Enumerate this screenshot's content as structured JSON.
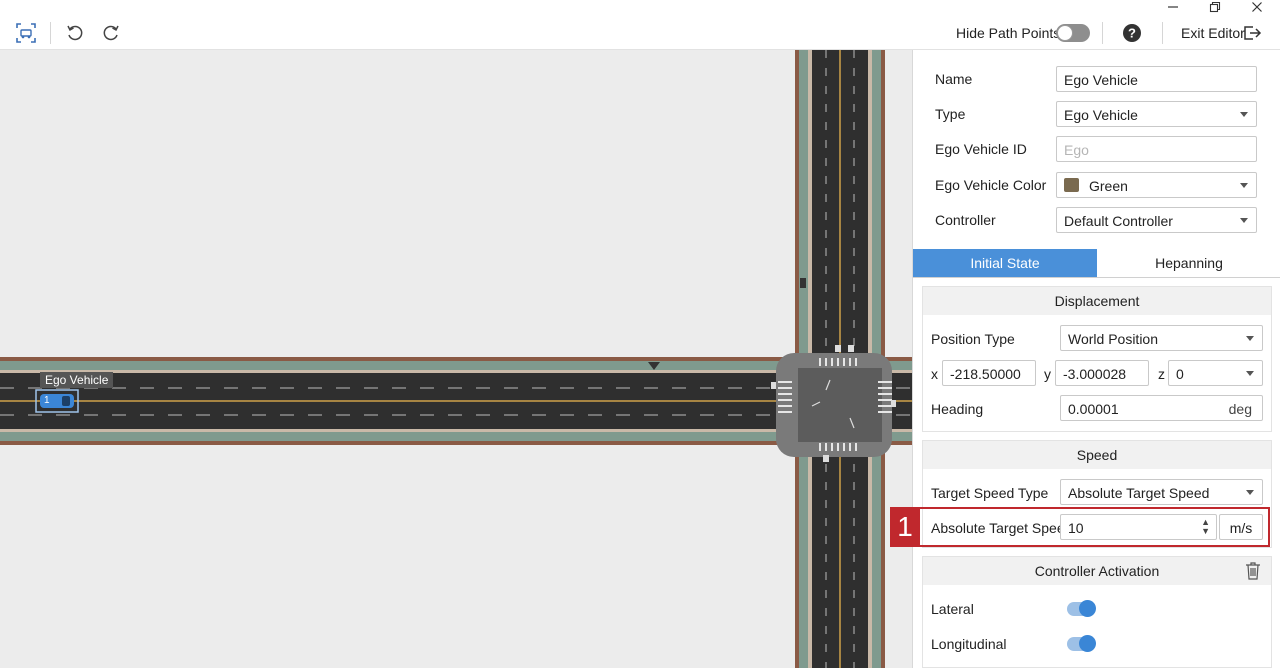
{
  "toolbar": {
    "hide_path_points_label": "Hide Path Points",
    "exit_editor_label": "Exit Editor",
    "icons": [
      "fit-view-icon",
      "undo-icon",
      "redo-icon",
      "help-icon",
      "exit-icon"
    ]
  },
  "window_controls": [
    "minimize",
    "restore",
    "close"
  ],
  "map": {
    "vehicle_label": "Ego Vehicle",
    "vehicle_marker": "1"
  },
  "form": {
    "name_label": "Name",
    "name_value": "Ego Vehicle",
    "type_label": "Type",
    "type_value": "Ego Vehicle",
    "id_label": "Ego Vehicle ID",
    "id_placeholder": "Ego",
    "color_label": "Ego Vehicle Color",
    "color_value": "Green",
    "color_swatch": "#7a6a4f",
    "controller_label": "Controller",
    "controller_value": "Default Controller"
  },
  "tabs": {
    "initial_state": "Initial State",
    "planning": "Hepanning"
  },
  "displacement": {
    "title": "Displacement",
    "position_type_label": "Position Type",
    "position_type_value": "World Position",
    "x_label": "x",
    "x_value": "-218.50000",
    "y_label": "y",
    "y_value": "-3.000028",
    "z_label": "z",
    "z_value": "0",
    "heading_label": "Heading",
    "heading_value": "0.00001",
    "heading_unit": "deg"
  },
  "speed": {
    "title": "Speed",
    "target_speed_type_label": "Target Speed Type",
    "target_speed_type_value": "Absolute Target Speed",
    "absolute_target_speed_label": "Absolute Target Speed",
    "absolute_target_speed_value": "10",
    "absolute_target_speed_unit": "m/s",
    "callout_number": "1"
  },
  "controller_activation": {
    "title": "Controller Activation",
    "lateral_label": "Lateral",
    "longitudinal_label": "Longitudinal"
  },
  "colors": {
    "accent": "#4a90d9",
    "callout": "#c0282d",
    "road": "#2f2f2f",
    "sidewalk": "#7f9a8e",
    "curb": "#8a5a45"
  }
}
